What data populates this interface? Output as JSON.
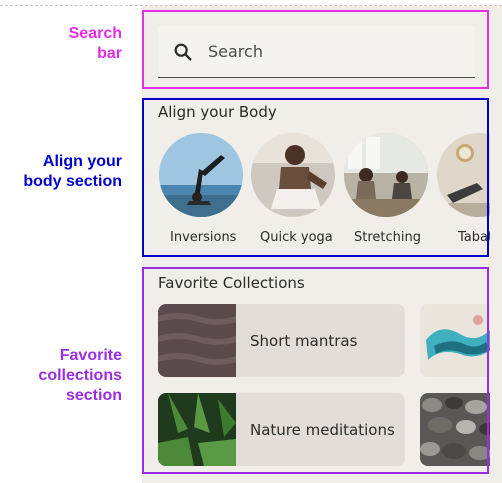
{
  "annotations": {
    "search": [
      "Search",
      "bar"
    ],
    "align": [
      "Align your",
      "body section"
    ],
    "favorites": [
      "Favorite",
      "collections",
      "section"
    ],
    "colors": {
      "search": "#e62ee6",
      "align": "#0000cc",
      "favorites": "#9a2ee6"
    }
  },
  "search": {
    "placeholder": "Search",
    "icon": "search-icon"
  },
  "align_section": {
    "title": "Align your Body",
    "items": [
      {
        "label": "Inversions"
      },
      {
        "label": "Quick yoga"
      },
      {
        "label": "Stretching"
      },
      {
        "label": "Tabata"
      }
    ]
  },
  "favorites_section": {
    "title": "Favorite Collections",
    "cards": [
      {
        "label": "Short mantras"
      },
      {
        "label": ""
      },
      {
        "label": "Nature meditations"
      },
      {
        "label": ""
      }
    ]
  }
}
